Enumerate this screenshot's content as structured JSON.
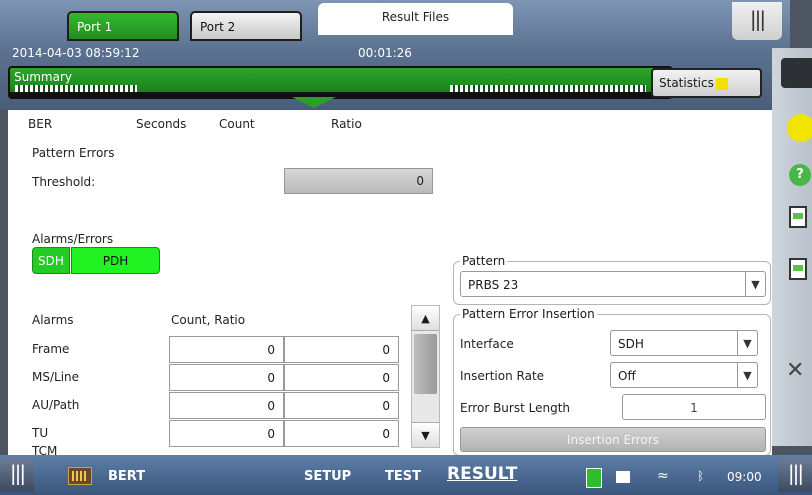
{
  "header": {
    "ports": [
      "Port 1",
      "Port 2"
    ],
    "result_files_tab": "Result Files",
    "datetime": "2014-04-03 08:59:12",
    "elapsed": "00:01:26",
    "summary_label": "Summary",
    "statistics_label": "Statistics"
  },
  "ber": {
    "heading": "BER",
    "col_seconds": "Seconds",
    "col_count": "Count",
    "col_ratio": "Ratio",
    "pattern_errors_label": "Pattern Errors",
    "threshold_label": "Threshold:",
    "threshold_value": "0"
  },
  "alarms": {
    "section_label": "Alarms/Errors",
    "toggle": [
      "SDH",
      "PDH"
    ],
    "col_alarms": "Alarms",
    "col_count_ratio": "Count, Ratio",
    "rows": [
      {
        "label": "Frame",
        "count": "0",
        "ratio": "0"
      },
      {
        "label": "MS/Line",
        "count": "0",
        "ratio": "0"
      },
      {
        "label": "AU/Path",
        "count": "0",
        "ratio": "0"
      },
      {
        "label": "TU",
        "count": "0",
        "ratio": "0"
      },
      {
        "label": "TCM",
        "count": "",
        "ratio": ""
      }
    ]
  },
  "pattern": {
    "group_title": "Pattern",
    "value": "PRBS 23"
  },
  "insertion": {
    "group_title": "Pattern Error Insertion",
    "interface_label": "Interface",
    "interface_value": "SDH",
    "rate_label": "Insertion Rate",
    "rate_value": "Off",
    "burst_label": "Error Burst Length",
    "burst_value": "1",
    "button_label": "Insertion Errors"
  },
  "footer": {
    "app_label": "BERT",
    "setup": "SETUP",
    "test": "TEST",
    "result": "RESULT",
    "time": "09:00"
  },
  "colors": {
    "active_green": "#23cb23",
    "status_yellow": "#f0e400",
    "topbar_blue": "#5c7291"
  },
  "icons": [
    "grip-icon",
    "bert-icon",
    "battery-icon",
    "camera-icon",
    "wifi-icon",
    "bluetooth-icon",
    "help-icon",
    "report-icon",
    "tools-icon"
  ]
}
